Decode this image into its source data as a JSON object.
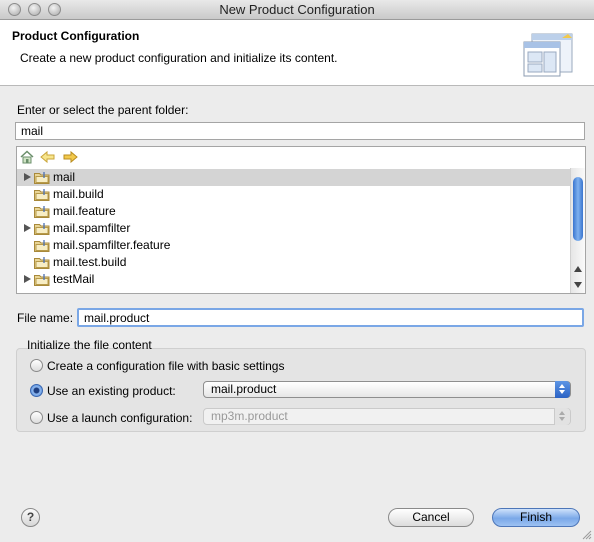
{
  "window": {
    "title": "New Product Configuration"
  },
  "header": {
    "title": "Product Configuration",
    "description": "Create a new product configuration and initialize its content."
  },
  "parent_folder": {
    "label": "Enter or select the parent folder:",
    "value": "mail"
  },
  "tree": {
    "toolbar_icons": [
      "home-icon",
      "back-arrow-icon",
      "forward-arrow-icon"
    ],
    "items": [
      {
        "label": "mail",
        "expandable": true,
        "selected": true
      },
      {
        "label": "mail.build",
        "expandable": false,
        "selected": false
      },
      {
        "label": "mail.feature",
        "expandable": false,
        "selected": false
      },
      {
        "label": "mail.spamfilter",
        "expandable": true,
        "selected": false
      },
      {
        "label": "mail.spamfilter.feature",
        "expandable": false,
        "selected": false
      },
      {
        "label": "mail.test.build",
        "expandable": false,
        "selected": false
      },
      {
        "label": "testMail",
        "expandable": true,
        "selected": false
      }
    ]
  },
  "file_name": {
    "label": "File name:",
    "value": "mail.product"
  },
  "init_group": {
    "title": "Initialize the file content",
    "options": [
      {
        "label": "Create a configuration file with basic settings",
        "selected": false
      },
      {
        "label": "Use an existing product:",
        "selected": true,
        "select_value": "mail.product",
        "select_enabled": true
      },
      {
        "label": "Use a launch configuration:",
        "selected": false,
        "select_value": "mp3m.product",
        "select_enabled": false
      }
    ]
  },
  "buttons": {
    "help": "?",
    "cancel": "Cancel",
    "finish": "Finish"
  },
  "colors": {
    "accent_blue": "#3a75cf",
    "focus_ring": "#7aa7e6",
    "selection_gray": "#d4d4d4",
    "window_bg": "#ececec"
  }
}
